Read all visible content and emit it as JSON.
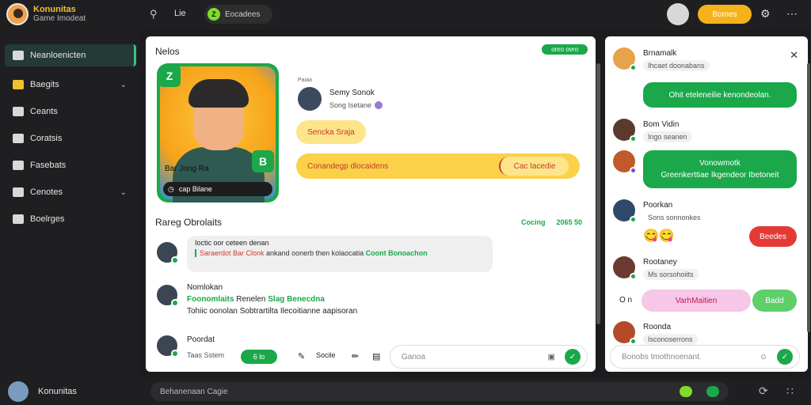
{
  "topbar": {
    "brand_title": "Konunitas",
    "brand_sub": "Game Imodeat",
    "search_icon": "search-icon",
    "lib_label": "Lie",
    "pill_label": "Eocadees",
    "pill_dot": "Z",
    "cta_label": "Bomes"
  },
  "sidebar": {
    "items": [
      {
        "label": "Neanloenicten",
        "icon": "home-icon",
        "chev": ""
      },
      {
        "label": "Baegits",
        "icon": "trophy-icon",
        "chev": "⌄"
      },
      {
        "label": "Ceants",
        "icon": "edit-icon",
        "chev": ""
      },
      {
        "label": "Coratsis",
        "icon": "folder-icon",
        "chev": ""
      },
      {
        "label": "Fasebats",
        "icon": "bookmark-icon",
        "chev": ""
      },
      {
        "label": "Cenotes",
        "icon": "gear-icon",
        "chev": "⌄"
      },
      {
        "label": "Boelrges",
        "icon": "layers-icon",
        "chev": ""
      }
    ]
  },
  "main": {
    "title": "Nelos",
    "badge": "onro ovro",
    "hero": {
      "tag": "Z",
      "tag2": "B",
      "name": "Bar Jong Ra",
      "bar_label": "cap Bilane"
    },
    "profile": {
      "pp": "Paiaa",
      "name": "Semy Sonok",
      "sub": "Song Isetane"
    },
    "yellow_bubble": "Sencka Sraja",
    "yellow_bar": {
      "left": "Conandegp dlocaidens",
      "right": "Cac Iacedie"
    },
    "section_title": "Rareg Obrolaits",
    "section_right": [
      "Cocing",
      "2065 50"
    ],
    "card1": {
      "line1": "Ioctic oor ceteen denan",
      "red": "Saraerdot Bar Clonk",
      "mid": " ankand oonerb then kolaocatia",
      "grn": "Coont Bonoachon"
    },
    "msg2": {
      "name": "Nomlokan",
      "grn1": "Foonomlaits",
      "mid": " Renelen ",
      "grn2": "Slag Benecdna",
      "line3": "Tohiic oonolan Sobtrartilta Ilecoitianne aapisoran"
    },
    "bottom": {
      "name": "Poordat",
      "sub": "Taas Sstem",
      "pill": "6 lo",
      "link": "Socile",
      "compose_placeholder": "Ganoa"
    }
  },
  "right": {
    "rows": [
      {
        "title": "Brnamalk",
        "sub": "Ihcaet doonabans"
      },
      {
        "title": "Bom Vidin",
        "sub": "Ingo seanen"
      },
      {
        "title": "Vonowmotk",
        "sub": ""
      },
      {
        "title": "Poorkan",
        "sub": "Sons sonnonkes"
      },
      {
        "title": "Rootaney",
        "sub": "Ms sorsohoiits"
      },
      {
        "title": "Roonda",
        "sub": "Isconoserrons"
      }
    ],
    "green1": "Ohit eteleneilie kenondeolan.",
    "green2a": "Vonowmotk",
    "green2b": "Greenkerttiae Ikgendeor Ibetoneit",
    "red_btn": "Beedes",
    "pink": "VarhMaitien",
    "lgreen": "Badd",
    "o_label": "O n",
    "compose_placeholder": "Bonobs tmothnoenant."
  },
  "bottombar": {
    "name": "Konunitas",
    "placeholder": "Behanenaan Cagie"
  }
}
